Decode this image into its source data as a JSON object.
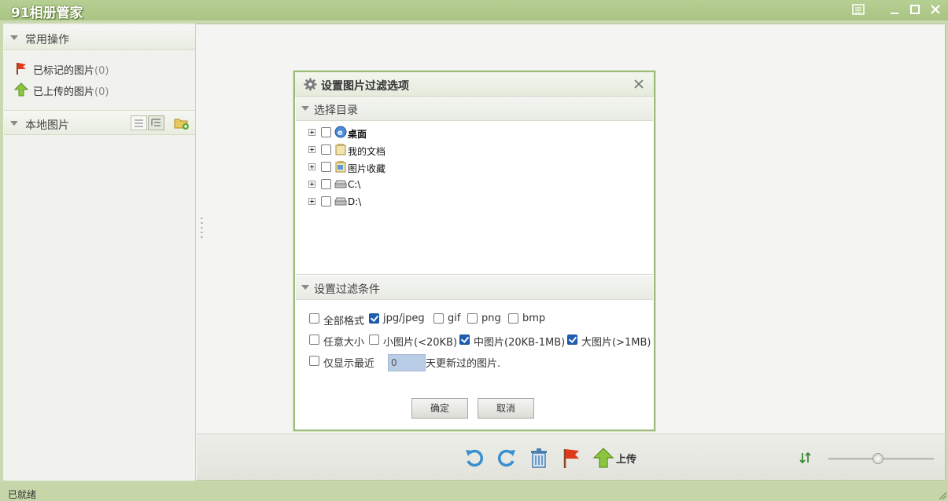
{
  "app": {
    "title": "91相册管家",
    "status": "已就绪"
  },
  "sidebar": {
    "common_header": "常用操作",
    "items": [
      {
        "label": "已标记的图片",
        "count": "(0)",
        "icon": "red-flag-icon"
      },
      {
        "label": "已上传的图片",
        "count": "(0)",
        "icon": "green-up-arrow-icon"
      }
    ],
    "local_header": "本地图片"
  },
  "dialog": {
    "title": "设置图片过滤选项",
    "dir_section": "选择目录",
    "tree": [
      {
        "label": "桌面",
        "icon": "desktop-icon",
        "checked": false
      },
      {
        "label": "我的文档",
        "icon": "documents-icon",
        "checked": false
      },
      {
        "label": "图片收藏",
        "icon": "pictures-icon",
        "checked": false
      },
      {
        "label": "C:\\",
        "icon": "drive-icon",
        "checked": false
      },
      {
        "label": "D:\\",
        "icon": "drive-icon",
        "checked": false
      }
    ],
    "filter_section": "设置过滤条件",
    "formats": [
      {
        "label": "全部格式",
        "checked": false
      },
      {
        "label": "jpg/jpeg",
        "checked": true
      },
      {
        "label": "gif",
        "checked": false
      },
      {
        "label": "png",
        "checked": false
      },
      {
        "label": "bmp",
        "checked": false
      }
    ],
    "sizes": [
      {
        "label": "任意大小",
        "checked": false
      },
      {
        "label": "小图片(<20KB)",
        "checked": false
      },
      {
        "label": "中图片(20KB-1MB)",
        "checked": true
      },
      {
        "label": "大图片(>1MB)",
        "checked": true
      }
    ],
    "recent": {
      "label": "仅显示最近",
      "days_value": "0",
      "suffix": "天更新过的图片.",
      "checked": false
    },
    "ok_label": "确定",
    "cancel_label": "取消"
  },
  "toolbar": {
    "upload_label": "上传",
    "zoom_level": 0.47
  },
  "colors": {
    "accent_green": "#a9c484",
    "checkbox_blue": "#1e5fb2"
  }
}
